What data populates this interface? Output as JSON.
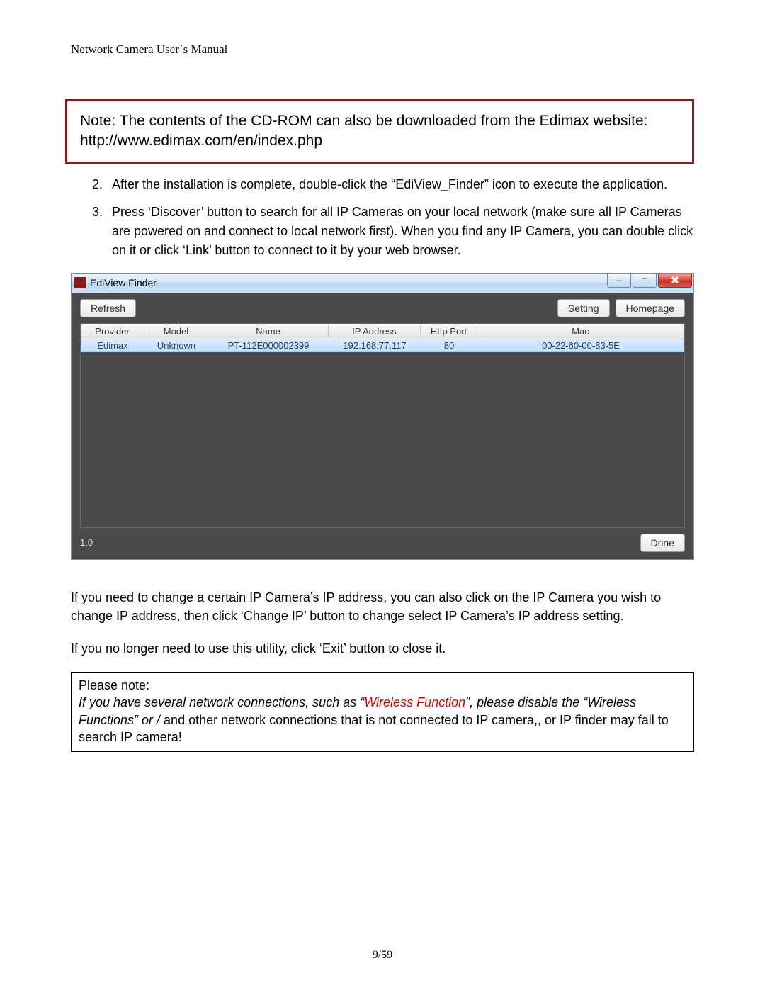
{
  "header": "Network Camera User`s Manual",
  "note_box": "Note: The contents of the CD-ROM can also be downloaded from the Edimax website: http://www.edimax.com/en/index.php",
  "steps": [
    {
      "num": "2.",
      "text": "After the installation is complete, double-click the “EdiView_Finder” icon to execute the application."
    },
    {
      "num": "3.",
      "text": "Press ‘Discover’ button to search for all IP Cameras on your local network (make sure all IP Cameras are powered on and connect to local network first). When you find any IP Camera, you can double click on it or click ‘Link’ button to connect to it by your web browser."
    }
  ],
  "app": {
    "title": "EdiView Finder",
    "buttons": {
      "refresh": "Refresh",
      "setting": "Setting",
      "homepage": "Homepage",
      "done": "Done"
    },
    "columns": {
      "provider": "Provider",
      "model": "Model",
      "name": "Name",
      "ip": "IP Address",
      "port": "Http Port",
      "mac": "Mac"
    },
    "rows": [
      {
        "provider": "Edimax",
        "model": "Unknown",
        "name": "PT-112E000002399",
        "ip": "192.168.77.117",
        "port": "80",
        "mac": "00-22-60-00-83-5E"
      }
    ],
    "version": "1.0"
  },
  "para1": "If you need to change a certain IP Camera’s IP address, you can also click on the IP Camera you wish to change IP address, then click ‘Change IP’ button to change select IP Camera’s IP address setting.",
  "para2": "If you no longer need to use this utility, click ‘Exit’ button to close it.",
  "please": {
    "title": "Please note:",
    "line_a": "If you have several network connections, such as “",
    "wireless": "Wireless Function",
    "line_b": "”, please disable the “Wireless Functions” or /",
    "line_c": " and other network connections that is not connected to IP camera,, or IP finder may fail to search IP camera!"
  },
  "pagenum": "9/59"
}
